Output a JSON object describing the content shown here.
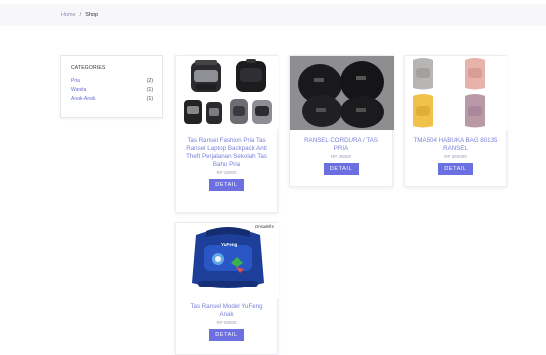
{
  "breadcrumb": {
    "home": "Home",
    "separator": "/",
    "current": "Shop"
  },
  "categories": {
    "title": "CATEGORIES",
    "items": [
      {
        "name": "Pria",
        "count": "(2)"
      },
      {
        "name": "Wanita",
        "count": "(1)"
      },
      {
        "name": "Anak-Anak",
        "count": "(1)"
      }
    ]
  },
  "products": [
    {
      "name": "Tas Ransel Fashion Pria Tas Ransel Laptop Backpack Anti Theft Perjalanan Sekolah Tas Bahu Pria",
      "price": "RP 30000",
      "button": "DETAIL",
      "image": "black-gray-backpacks"
    },
    {
      "name": "RANSEL CORDURA / TAS PRIA",
      "price": "RP 35000",
      "button": "DETAIL",
      "image": "black-cordura-backpacks"
    },
    {
      "name": "TMA504 HABUKA BAG 80135 RANSEL",
      "price": "RP 350000",
      "button": "DETAIL",
      "image": "pastel-backpacks"
    },
    {
      "name": "Tas Ransel Model YuFeng Anak",
      "price": "RP 50000",
      "button": "DETAIL",
      "image": "blue-kids-backpack",
      "seller_logo": "Onsalefrs",
      "bag_text": "YuFeng"
    }
  ],
  "colors": {
    "accent": "#6b6fe0",
    "link": "#6a6fd1",
    "product_name": "#7b80d6"
  }
}
